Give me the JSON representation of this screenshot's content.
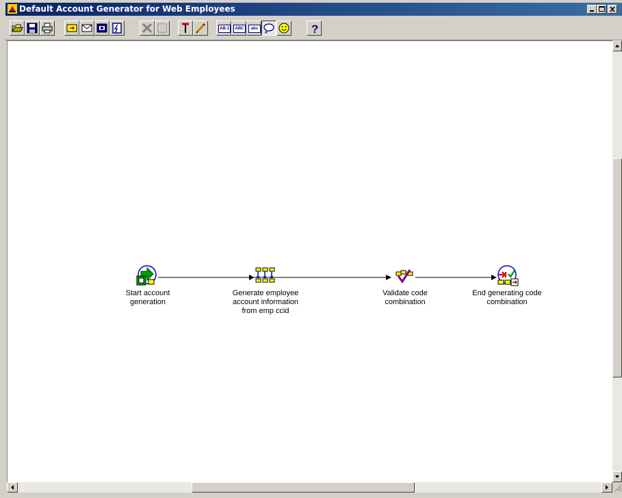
{
  "window": {
    "title": "Default Account Generator for Web Employees",
    "controls": [
      "minimize-icon",
      "maximize-icon",
      "close-icon"
    ]
  },
  "toolbar": {
    "buttons": [
      {
        "name": "open-icon"
      },
      {
        "name": "save-icon"
      },
      {
        "name": "print-icon"
      },
      {
        "name": "new-process-icon"
      },
      {
        "name": "new-notification-icon"
      },
      {
        "name": "new-function-icon"
      },
      {
        "name": "new-event-icon"
      },
      {
        "name": "delete-icon"
      },
      {
        "name": "properties-icon"
      },
      {
        "name": "push-pin-icon"
      },
      {
        "name": "pencil-icon"
      },
      {
        "name": "label-internal-name-icon",
        "text": "AB-1"
      },
      {
        "name": "label-display-name-icon",
        "text": "ABC"
      },
      {
        "name": "label-instance-label-icon",
        "text": "abc"
      },
      {
        "name": "comment-icon",
        "pressed": true
      },
      {
        "name": "smiley-icon"
      },
      {
        "name": "help-icon"
      }
    ]
  },
  "diagram": {
    "nodes": [
      {
        "id": "start",
        "label_line1": "Start account",
        "label_line2": "generation",
        "label_line3": ""
      },
      {
        "id": "generate",
        "label_line1": "Generate employee",
        "label_line2": "account information",
        "label_line3": "from emp ccid"
      },
      {
        "id": "validate",
        "label_line1": "Validate code",
        "label_line2": "combination",
        "label_line3": ""
      },
      {
        "id": "end",
        "label_line1": "End generating code",
        "label_line2": "combination",
        "label_line3": ""
      }
    ],
    "transitions": [
      [
        "start",
        "generate"
      ],
      [
        "generate",
        "validate"
      ],
      [
        "validate",
        "end"
      ]
    ]
  },
  "colors": {
    "titlebar": "#0a246a",
    "node_yellow": "#ffff00",
    "node_blue": "#0000c0",
    "start_green": "#00a000",
    "end_red": "#e00000",
    "check_purple": "#800080"
  }
}
